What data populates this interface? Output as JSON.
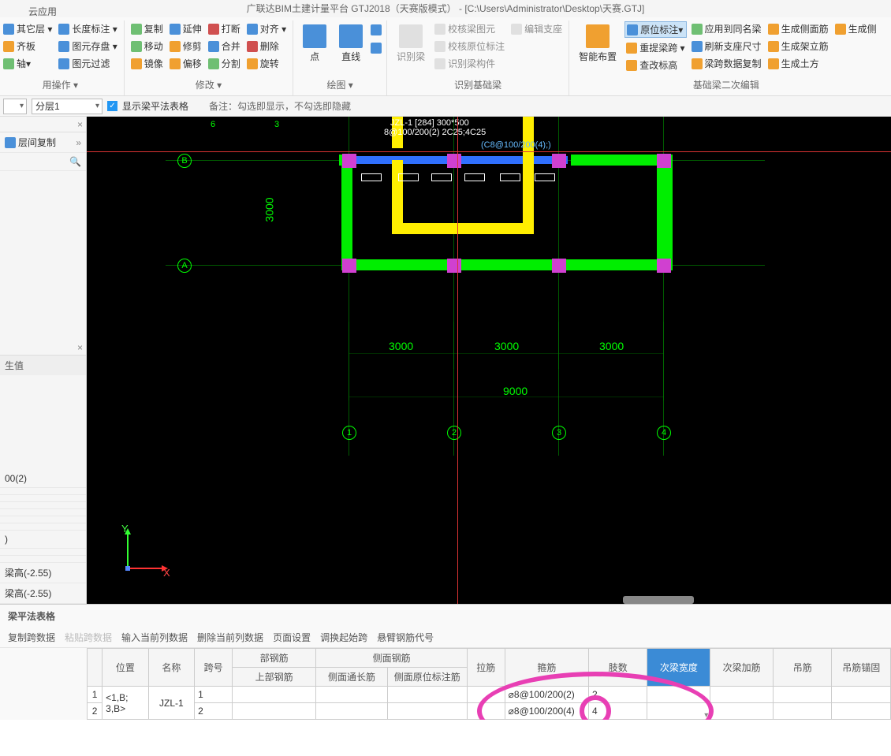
{
  "app": {
    "title": "广联达BIM土建计量平台 GTJ2018（天赛版模式） - [C:\\Users\\Administrator\\Desktop\\天赛.GTJ]",
    "cloud_app": "云应用"
  },
  "ribbon": {
    "groups": {
      "dim_ops": {
        "label": "用操作 ▾",
        "btns": {
          "other_layer": "其它层 ▾",
          "length_dim": "长度标注 ▾",
          "align_plate": "齐板",
          "save_elems": "图元存盘 ▾",
          "axis": "轴▾",
          "filter_elems": "图元过滤"
        }
      },
      "modify": {
        "label": "修改 ▾",
        "btns": {
          "copy": "复制",
          "extend": "延伸",
          "break": "打断",
          "align": "对齐 ▾",
          "move": "移动",
          "trim": "修剪",
          "merge": "合并",
          "delete": "删除",
          "mirror": "镜像",
          "offset": "偏移",
          "split": "分割",
          "rotate": "旋转"
        }
      },
      "draw": {
        "label": "绘图 ▾",
        "btns": {
          "point": "点",
          "line": "直线"
        }
      },
      "recognize_base": {
        "label": "识别基础梁",
        "btns": {
          "rec_beam": "识别梁",
          "check_elem": "校核梁图元",
          "check_orig": "校核原位标注",
          "edit_support": "编辑支座",
          "rec_beam_comp": "识别梁构件"
        }
      },
      "beam_edit": {
        "label": "基础梁二次编辑",
        "btns": {
          "smart_layout": "智能布置",
          "orig_annot": "原位标注▾",
          "apply_same": "应用到同名梁",
          "gen_side": "生成侧面筋",
          "relift_span": "重提梁跨 ▾",
          "refresh_sup": "刷新支座尺寸",
          "gen_frame": "生成架立筋",
          "check_elev": "查改标高",
          "copy_span_data": "梁跨数据复制",
          "gen_earth": "生成土方",
          "gen_side2": "生成侧"
        }
      }
    }
  },
  "toolbar": {
    "layer_combo": "分层1",
    "checkbox_label": "显示梁平法表格",
    "note": "备注：勾选即显示，不勾选即隐藏"
  },
  "left_panel": {
    "layer_copy": "层间复制",
    "prop_header": "生值",
    "rows": [
      "00(2)",
      ")",
      "梁高(-2.55)",
      "梁高(-2.55)"
    ],
    "close1": "×",
    "close2": "×",
    "search": "🔍",
    "expand": "»"
  },
  "canvas": {
    "annot1": "JZL-1 [284] 300*500",
    "annot2": "8@100/200(2) 2C25;4C25",
    "annot3": "(C8@100/200(4);)",
    "axes": {
      "A": "A",
      "B": "B",
      "n1": "1",
      "n2": "2",
      "n3": "3",
      "n4": "4"
    },
    "dims": {
      "d3000": "3000",
      "d9000": "9000"
    },
    "dim_left_top": "6",
    "dim_left_mid": "3",
    "dim_vert": "3000",
    "coord": {
      "x": "X",
      "y": "Y"
    }
  },
  "bottom": {
    "title": "梁平法表格",
    "toolbar": {
      "copy_span": "复制跨数据",
      "paste_span": "粘贴跨数据",
      "input_col": "输入当前列数据",
      "delete_col": "删除当前列数据",
      "page_setup": "页面设置",
      "swap_span": "调换起始跨",
      "cantilever": "悬臂钢筋代号"
    },
    "headers": {
      "pos": "位置",
      "name": "名称",
      "span_no": "跨号",
      "top_group": "部钢筋",
      "top_sub": "上部钢筋",
      "side_group": "侧面钢筋",
      "side_through": "侧面通长筋",
      "side_orig": "侧面原位标注筋",
      "tie": "拉筋",
      "stirrup": "箍筋",
      "limbs": "肢数",
      "sub_width": "次梁宽度",
      "sub_add": "次梁加筋",
      "hanger": "吊筋",
      "hanger_anchor": "吊筋锚固"
    },
    "rows": [
      {
        "idx": "1",
        "pos": "<1,B;",
        "name": "JZL-1",
        "span": "1",
        "stirrup": "⌀8@100/200(2)",
        "limbs": "2"
      },
      {
        "idx": "2",
        "pos": "3,B>",
        "name": "",
        "span": "2",
        "stirrup": "⌀8@100/200(4)",
        "limbs": "4"
      }
    ]
  }
}
